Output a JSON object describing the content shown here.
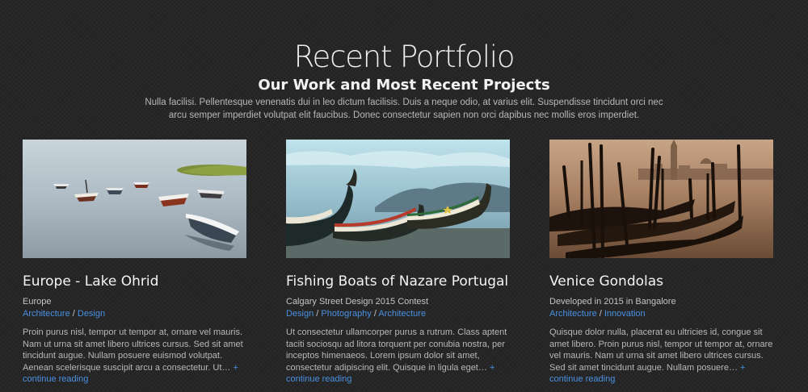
{
  "section": {
    "title": "Recent Portfolio",
    "subtitle": "Our Work and Most Recent Projects",
    "intro": "Nulla facilisi. Pellentesque venenatis dui in leo dictum facilisis. Duis a neque odio, at varius elit. Suspendisse tincidunt orci nec arcu semper imperdiet volutpat elit faucibus. Donec consectetur sapien non orci dapibus nec mollis eros imperdiet."
  },
  "colors": {
    "background": "#262626",
    "link": "#4a90e2",
    "heading": "#eeeeee"
  },
  "projects": [
    {
      "title": "Europe - Lake Ohrid",
      "meta": "Europe",
      "tags": [
        "Architecture",
        "Design"
      ],
      "excerpt": "Proin purus nisl, tempor ut tempor at, ornare vel mauris. Nam ut urna sit amet libero ultrices cursus. Sed sit amet tincidunt augue. Nullam posuere euismod volutpat. Aenean scelerisque suscipit arcu a consectetur. Ut…",
      "more": "+ continue reading",
      "image": "rowboats-on-calm-lake"
    },
    {
      "title": "Fishing Boats of Nazare Portugal",
      "meta": "Calgary Street Design 2015 Contest",
      "tags": [
        "Design",
        "Photography",
        "Architecture"
      ],
      "excerpt": "Ut consectetur ullamcorper purus a rutrum. Class aptent taciti sociosqu ad litora torquent per conubia nostra, per inceptos himenaeos. Lorem ipsum dolor sit amet, consectetur adipiscing elit. Quisque in ligula eget…",
      "more": "+ continue reading",
      "image": "fishing-boats-on-beach"
    },
    {
      "title": "Venice Gondolas",
      "meta": "Developed in 2015 in Bangalore",
      "tags": [
        "Architecture",
        "Innovation"
      ],
      "excerpt": "Quisque dolor nulla, placerat eu ultricies id, congue sit amet libero. Proin purus nisl, tempor ut tempor at, ornare vel mauris. Nam ut urna sit amet libero ultrices cursus. Sed sit amet tincidunt augue. Nullam posuere…",
      "more": "+ continue reading",
      "image": "gondolas-sepia"
    }
  ]
}
